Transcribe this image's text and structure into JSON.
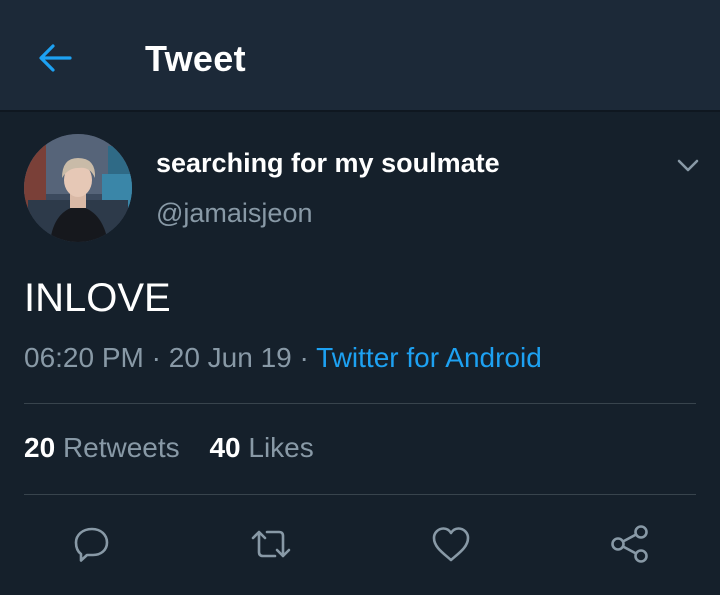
{
  "header": {
    "title": "Tweet",
    "back_icon": "arrow-left-icon",
    "accent_color": "#1da1f2"
  },
  "tweet": {
    "display_name": "searching for my soulmate",
    "handle": "@jamaisjeon",
    "text": "INLOVE",
    "time": "06:20 PM",
    "date": "20 Jun 19",
    "source": "Twitter for Android",
    "separator": "·"
  },
  "stats": {
    "retweets_count": "20",
    "retweets_label": "Retweets",
    "likes_count": "40",
    "likes_label": "Likes"
  },
  "actions": [
    {
      "icon": "reply-icon"
    },
    {
      "icon": "retweet-icon"
    },
    {
      "icon": "like-icon"
    },
    {
      "icon": "share-icon"
    }
  ]
}
